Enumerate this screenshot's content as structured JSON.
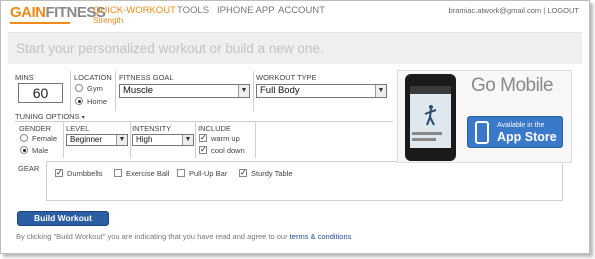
{
  "header": {
    "logo_gain": "GAIN",
    "logo_fitness": "FITNESS",
    "nav": [
      {
        "label": "QUICK-WORKOUT",
        "sub": "Strength",
        "active": true
      },
      {
        "label": "TOOLS"
      },
      {
        "label": "IPHONE APP"
      },
      {
        "label": "ACCOUNT"
      }
    ],
    "user_email": "bramiac.atwork@gmail.com",
    "separator": "|",
    "logout": "LOGOUT"
  },
  "banner": {
    "text": "Start your personalized workout or build a new one."
  },
  "form": {
    "mins_label": "MINS",
    "mins_value": "60",
    "location_label": "LOCATION",
    "location_options": [
      {
        "label": "Gym",
        "selected": false
      },
      {
        "label": "Home",
        "selected": true
      }
    ],
    "fitness_goal_label": "FITNESS GOAL",
    "fitness_goal_value": "Muscle",
    "workout_type_label": "WORKOUT TYPE",
    "workout_type_value": "Full Body",
    "tuning_label": "TUNING OPTIONS",
    "tuning_icon": "chevron-down-icon",
    "gender_label": "GENDER",
    "gender_options": [
      {
        "label": "Female",
        "selected": false
      },
      {
        "label": "Male",
        "selected": true
      }
    ],
    "level_label": "LEVEL",
    "level_value": "Beginner",
    "intensity_label": "INTENSITY",
    "intensity_value": "High",
    "include_label": "INCLUDE",
    "include_options": [
      {
        "label": "warm up",
        "checked": true
      },
      {
        "label": "cool down",
        "checked": true
      }
    ],
    "gear_label": "GEAR",
    "gear_options": [
      {
        "label": "Dumbbells",
        "checked": true
      },
      {
        "label": "Exercise Ball",
        "checked": false
      },
      {
        "label": "Pull-Up Bar",
        "checked": false
      },
      {
        "label": "Sturdy Table",
        "checked": true
      }
    ],
    "build_button": "Build Workout",
    "agree_text": "By clicking \"Build Workout\" you are indicating that you have read and agree to our",
    "terms_link": "terms & conditions"
  },
  "ad": {
    "title": "Go Mobile",
    "appstore_small": "Available in the",
    "appstore_big": "App Store"
  },
  "colors": {
    "brand_orange": "#f08a1c",
    "button_blue": "#2a5fa3",
    "appstore_blue": "#3a78c9",
    "link_blue": "#1f4f9b"
  }
}
